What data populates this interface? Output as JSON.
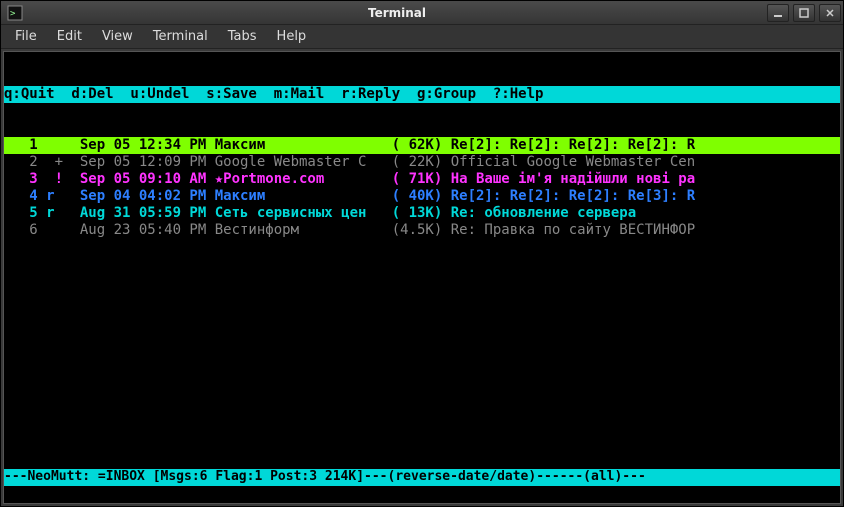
{
  "window": {
    "title": "Terminal"
  },
  "menubar": [
    "File",
    "Edit",
    "View",
    "Terminal",
    "Tabs",
    "Help"
  ],
  "helpbar": "q:Quit  d:Del  u:Undel  s:Save  m:Mail  r:Reply  g:Group  ?:Help           ",
  "messages": [
    {
      "cls": "sel",
      "num": "   1     ",
      "date": "Sep 05 12:34 PM ",
      "from": "Максим               ",
      "size": "( 62K) ",
      "subj": "Re[2]: Re[2]: Re[2]: Re[2]: R"
    },
    {
      "cls": "gray",
      "num": "   2  +  ",
      "date": "Sep 05 12:09 PM ",
      "from": "Google Webmaster C   ",
      "size": "( 22K) ",
      "subj": "Official Google Webmaster Cen"
    },
    {
      "cls": "mag",
      "num": "   3  !  ",
      "date": "Sep 05 09:10 AM ",
      "from": "★Portmone.com        ",
      "size": "( 71K) ",
      "subj": "На Ваше ім'я надійшли нові ра"
    },
    {
      "cls": "blue",
      "num": "   4 r   ",
      "date": "Sep 04 04:02 PM ",
      "from": "Максим               ",
      "size": "( 40K) ",
      "subj": "Re[2]: Re[2]: Re[2]: Re[3]: R"
    },
    {
      "cls": "cyan",
      "num": "   5 r   ",
      "date": "Aug 31 05:59 PM ",
      "from": "Сеть сервисных цен   ",
      "size": "( 13K) ",
      "subj": "Re: обновление сервера       "
    },
    {
      "cls": "gray",
      "num": "   6     ",
      "date": "Aug 23 05:40 PM ",
      "from": "Вестинформ           ",
      "size": "(4.5K) ",
      "subj": "Re: Правка по сайту ВЕСТИНФОР"
    }
  ],
  "statusbar": "---NeoMutt: =INBOX [Msgs:6 Flag:1 Post:3 214K]---(reverse-date/date)------(all)---"
}
